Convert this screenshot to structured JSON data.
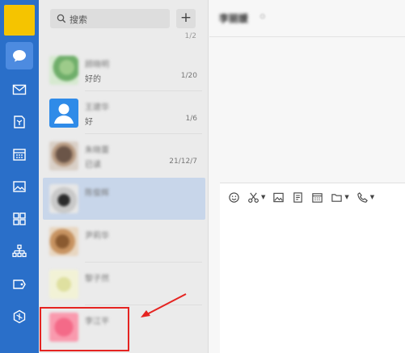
{
  "search": {
    "placeholder": "搜索"
  },
  "actions": {
    "add_label": "+"
  },
  "list_top_fragment": "1/2",
  "conversations": [
    {
      "name": "顾晓明",
      "message": "好的",
      "time": "1/20",
      "avatar": "green"
    },
    {
      "name": "王建华",
      "message": "好",
      "time": "1/6",
      "avatar": "person"
    },
    {
      "name": "朱晓蕾",
      "message": "已读",
      "time": "21/12/7",
      "avatar": "dark"
    },
    {
      "name": "陈俊辉",
      "message": "",
      "time": "",
      "avatar": "black",
      "selected": true
    },
    {
      "name": "尹莉华",
      "message": "",
      "time": "",
      "avatar": "brown"
    },
    {
      "name": "黎子然",
      "message": "",
      "time": "",
      "avatar": "yellow"
    },
    {
      "name": "李江平",
      "message": "",
      "time": "",
      "avatar": "pink"
    }
  ],
  "chat": {
    "title": "李丽媛",
    "title_mark": "⊙"
  },
  "toolbar_icons": [
    "emoji-icon",
    "scissors-icon",
    "image-icon",
    "document-icon",
    "calendar-icon",
    "folder-icon",
    "phone-icon"
  ],
  "colors": {
    "rail": "#2a6fc9",
    "avatar_box": "#f5c400",
    "selected_row": "#c8d6ea",
    "annotation": "#e52421"
  }
}
